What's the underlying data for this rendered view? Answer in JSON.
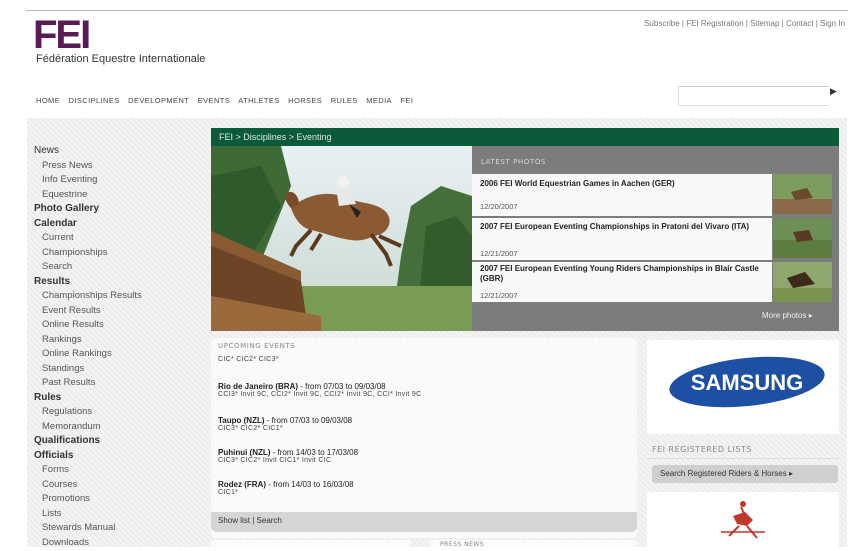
{
  "brand": {
    "logo_text": "FEI",
    "tagline": "Fédération Equestre Internationale"
  },
  "toplinks": [
    "Subscribe",
    "FEI Registration",
    "Sitemap",
    "Contact",
    "Sign In"
  ],
  "mainnav": [
    "HOME",
    "DISCIPLINES",
    "DEVELOPMENT",
    "EVENTS",
    "ATHLETES",
    "HORSES",
    "RULES",
    "MEDIA",
    "FEI"
  ],
  "breadcrumb": "FEI > Disciplines > Eventing",
  "sidebar": [
    {
      "label": "News",
      "type": "section",
      "bold": false
    },
    {
      "label": "Press News",
      "type": "item"
    },
    {
      "label": "Info Eventing",
      "type": "item"
    },
    {
      "label": "Equestrine",
      "type": "item"
    },
    {
      "label": "Photo Gallery",
      "type": "section",
      "bold": true
    },
    {
      "label": "Calendar",
      "type": "section",
      "bold": true
    },
    {
      "label": "Current",
      "type": "item"
    },
    {
      "label": "Championships",
      "type": "item"
    },
    {
      "label": "Search",
      "type": "item"
    },
    {
      "label": "Results",
      "type": "section",
      "bold": true
    },
    {
      "label": "Championships Results",
      "type": "item"
    },
    {
      "label": "Event Results",
      "type": "item"
    },
    {
      "label": "Online Results",
      "type": "item"
    },
    {
      "label": "Rankings",
      "type": "item"
    },
    {
      "label": "Online Rankings",
      "type": "item"
    },
    {
      "label": "Standings",
      "type": "item"
    },
    {
      "label": "Past Results",
      "type": "item"
    },
    {
      "label": "Rules",
      "type": "section",
      "bold": true
    },
    {
      "label": "Regulations",
      "type": "item"
    },
    {
      "label": "Memorandum",
      "type": "item"
    },
    {
      "label": "Qualifications",
      "type": "section",
      "bold": true
    },
    {
      "label": "Officials",
      "type": "section",
      "bold": true
    },
    {
      "label": "Forms",
      "type": "item"
    },
    {
      "label": "Courses",
      "type": "item"
    },
    {
      "label": "Promotions",
      "type": "item"
    },
    {
      "label": "Lists",
      "type": "item"
    },
    {
      "label": "Stewards Manual",
      "type": "item"
    },
    {
      "label": "Downloads",
      "type": "item"
    }
  ],
  "latest_photos": {
    "heading": "LATEST PHOTOS",
    "items": [
      {
        "title": "2006 FEI World Equestrian Games in Aachen (GER)",
        "date": "12/20/2007"
      },
      {
        "title": "2007 FEI European Eventing Championships in Pratoni del Vivaro (ITA)",
        "date": "12/21/2007"
      },
      {
        "title": "2007 FEI European Eventing Young Riders Championships in Blair Castle (GBR)",
        "date": "12/21/2007"
      }
    ],
    "more": "More photos"
  },
  "upcoming": {
    "heading": "UPCOMING EVENTS",
    "events": [
      {
        "name": "",
        "detail": "",
        "cats": "CIC* CIC2* CIC3*"
      },
      {
        "name": "Rio de Janeiro (BRA)",
        "detail": " - from 07/03 to 09/03/08",
        "cats": "CCI3* Invit 9C, CCI2* Invit 9C, CCI2* Invit 9C, CCI* Invit 9C"
      },
      {
        "name": "Taupo (NZL)",
        "detail": " - from 07/03 to 09/03/08",
        "cats": "CIC3* CIC2* CIC1*"
      },
      {
        "name": "Puhinui (NZL)",
        "detail": " - from 14/03 to 17/03/08",
        "cats": "CIC3* CIC2* Invit CIC1* Invit CIC"
      },
      {
        "name": "Rodez (FRA)",
        "detail": " - from 14/03 to 16/03/08",
        "cats": "CIC1*"
      }
    ],
    "footer": "Show list  |  Search"
  },
  "sponsor": "SAMSUNG",
  "registered": {
    "heading": "FEI REGISTERED LISTS",
    "button": "Search Registered Riders & Horses"
  },
  "bottom": {
    "press_heading": "PRESS NEWS"
  },
  "colors": {
    "brand_purple": "#5a1a55",
    "nav_green": "#0b5a3a",
    "samsung_blue": "#1d4fa3"
  }
}
